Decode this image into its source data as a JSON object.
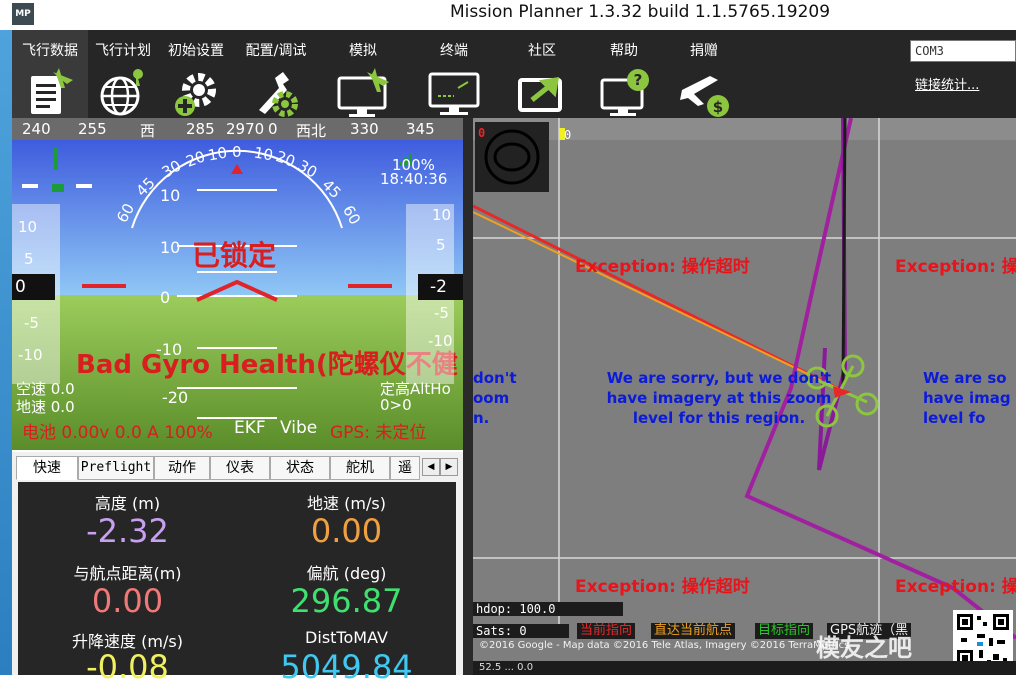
{
  "window": {
    "title": "Mission Planner 1.3.32 build 1.1.5765.19209",
    "icon_text": "MP"
  },
  "menu": [
    {
      "label": "飞行数据",
      "icon": "flight-data-icon",
      "active": true
    },
    {
      "label": "飞行计划",
      "icon": "flight-plan-icon"
    },
    {
      "label": "初始设置",
      "icon": "initial-setup-icon"
    },
    {
      "label": "配置/调试",
      "icon": "config-tuning-icon"
    },
    {
      "label": "模拟",
      "icon": "simulation-icon"
    },
    {
      "label": "终端",
      "icon": "terminal-icon"
    },
    {
      "label": "社区",
      "icon": "community-icon"
    },
    {
      "label": "帮助",
      "icon": "help-icon"
    },
    {
      "label": "捐赠",
      "icon": "donate-icon"
    }
  ],
  "connection": {
    "port": "COM3",
    "link_stats": "链接统计..."
  },
  "hud": {
    "heading_labels": [
      "240",
      "255",
      "西",
      "285",
      "2970",
      "0",
      "西北",
      "330",
      "345"
    ],
    "time": "18:40:36",
    "battery_pct_top": "100%",
    "pitch_labels": {
      "p10_left": "10",
      "p10_right": "10",
      "p0": "0",
      "m10": "-10",
      "m20": "-20"
    },
    "arc_labels": [
      "60",
      "45",
      "30",
      "20",
      "10",
      "0",
      "10",
      "20",
      "30",
      "45",
      "60"
    ],
    "armed_state": "已锁定",
    "warning": "Bad Gyro Health(陀螺仪不健",
    "airspeed": "空速 0.0",
    "groundspeed": "地速 0.0",
    "alt_mode": "定高AltHo",
    "alt_change": "0>0",
    "battery_line": "电池 0.00v 0.0 A 100%",
    "ekf": "EKF",
    "vibe": "Vibe",
    "gps": "GPS: 未定位",
    "speed_tape": [
      "10",
      "5",
      "0",
      "-5",
      "-10"
    ],
    "alt_tape": [
      "10",
      "5",
      "-2",
      "-5",
      "-10"
    ],
    "speed_box": "0",
    "alt_box": "-2"
  },
  "tabs": [
    "快速",
    "Preflight",
    "动作",
    "仪表",
    "状态",
    "舵机",
    "遥"
  ],
  "quick": [
    {
      "label": "高度 (m)",
      "value": "-2.32",
      "color": "#c8a0f0"
    },
    {
      "label": "地速 (m/s)",
      "value": "0.00",
      "color": "#f0a040"
    },
    {
      "label": "与航点距离(m)",
      "value": "0.00",
      "color": "#f07878"
    },
    {
      "label": "偏航 (deg)",
      "value": "296.87",
      "color": "#40e070"
    },
    {
      "label": "升降速度 (m/s)",
      "value": "-0.08",
      "color": "#f0f060"
    },
    {
      "label": "DistToMAV",
      "value": "5049.84",
      "color": "#40c8f0"
    }
  ],
  "map": {
    "corner_left": "0",
    "corner_right": "0",
    "error": "Exception: 操作超时",
    "error_short": "Exception: 操",
    "sorry_left": [
      "don't",
      "oom",
      "n."
    ],
    "sorry_center": [
      "We are sorry, but we don't",
      "have imagery at this zoom",
      "level for this region."
    ],
    "sorry_right": [
      "We are so",
      "have imag",
      "level fo"
    ],
    "hdop": "hdop: 100.0",
    "sats": "Sats: 0",
    "legend": [
      {
        "text": "当前指向",
        "color": "#e82828"
      },
      {
        "text": "直达当前航点",
        "color": "#f0a020"
      },
      {
        "text": "目标指向",
        "color": "#28c828"
      },
      {
        "text": "GPS航迹（黑",
        "color": "#f0f0f0"
      }
    ],
    "attribution": "©2016 Google - Map data ©2016 Tele Atlas, Imagery ©2016 TerraMetrics",
    "watermark": "模友之吧",
    "status_line": "52.5 ... 0.0"
  }
}
